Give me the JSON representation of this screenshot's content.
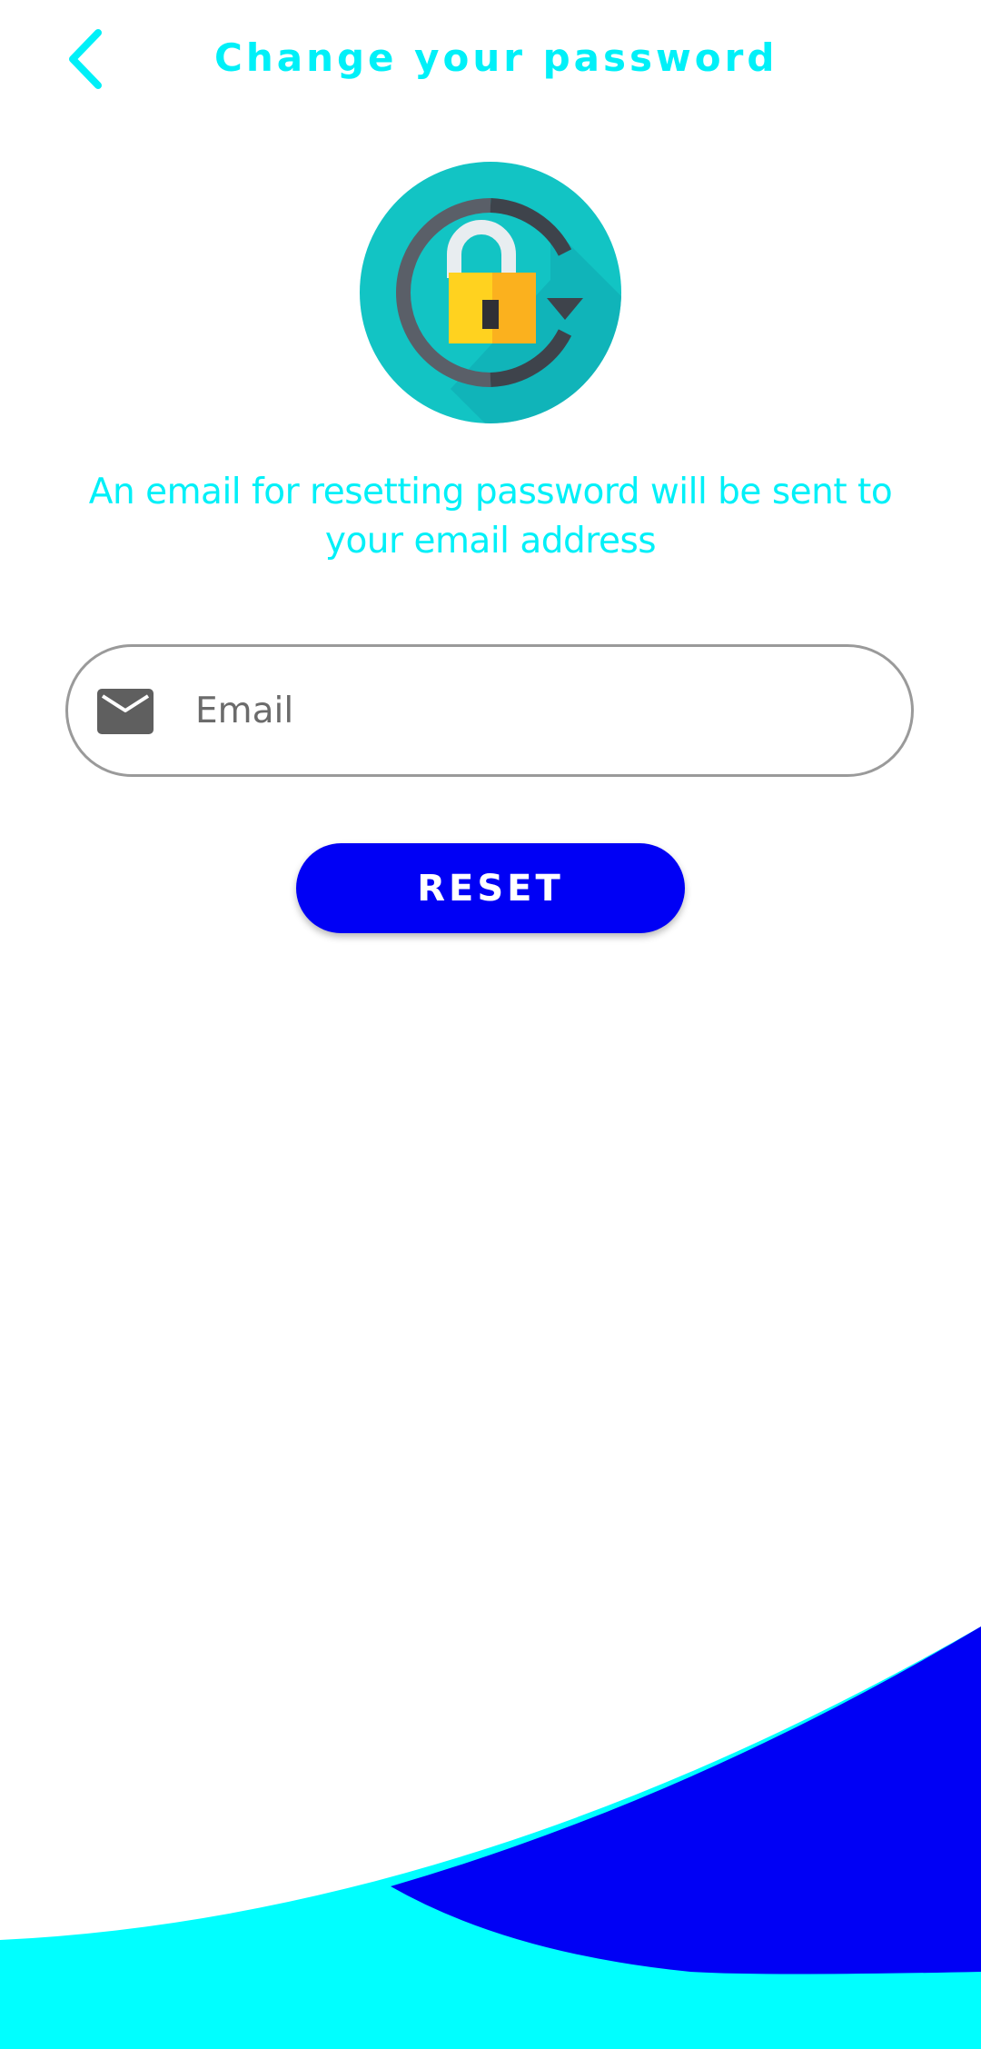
{
  "header": {
    "title": "Change your password",
    "back_icon": "chevron-left-icon"
  },
  "hero": {
    "icon": "lock-reset-icon"
  },
  "description": "An email for resetting password will be sent to your email address",
  "email_field": {
    "icon": "mail-icon",
    "placeholder": "Email",
    "value": ""
  },
  "reset_button": {
    "label": "RESET"
  },
  "colors": {
    "accent_cyan": "#00F0F8",
    "primary_blue": "#0000F5",
    "wave_cyan": "#00FFFF",
    "icon_teal": "#12C4C4",
    "lock_yellow": "#FFC107",
    "field_border": "#9A9A9A"
  }
}
